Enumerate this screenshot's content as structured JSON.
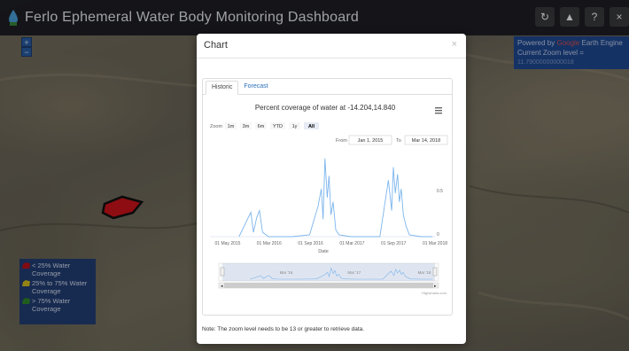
{
  "app": {
    "title": "Ferlo Ephemeral Water Body Monitoring Dashboard"
  },
  "top_icons": [
    {
      "name": "refresh-icon",
      "glyph": "↻"
    },
    {
      "name": "image-icon",
      "glyph": "▲"
    },
    {
      "name": "help-icon",
      "glyph": "?"
    },
    {
      "name": "close-icon",
      "glyph": "×"
    }
  ],
  "zoom": {
    "in": "+",
    "out": "−"
  },
  "powered": {
    "line1_prefix": "Powered by",
    "line1_mid": "Google",
    "line1_suffix": "Earth Engine",
    "line2": "Current Zoom level =",
    "line3": "11.79000000000018"
  },
  "legend": {
    "items": [
      {
        "label": "< 25% Water Coverage",
        "color": "#c0111c"
      },
      {
        "label": "25% to 75% Water Coverage",
        "color": "#d8c21f"
      },
      {
        "label": "> 75% Water Coverage",
        "color": "#2f8a2a"
      }
    ]
  },
  "modal": {
    "title": "Chart",
    "close": "×",
    "tabs": [
      {
        "label": "Historic",
        "active": true
      },
      {
        "label": "Forecast",
        "active": false
      }
    ],
    "note": "Note: The zoom level needs to be 13 or greater to retrieve data."
  },
  "chart_data": {
    "type": "line",
    "title": "Percent coverage of water at -14.204,14.840",
    "zoom_label": "Zoom",
    "range_buttons": [
      "1m",
      "3m",
      "6m",
      "YTD",
      "1y",
      "All"
    ],
    "selected_range": "All",
    "from_label": "From",
    "from_value": "Jan 1, 2015",
    "to_label": "To",
    "to_value": "Mar 14, 2018",
    "xlabel": "Date",
    "x_ticks": [
      "01 May 2015",
      "01 Mar 2016",
      "01 Sep 2016",
      "01 Mar 2017",
      "01 Sep 2017",
      "01 Mar 2018"
    ],
    "y_ticks": [
      "0",
      "0.5"
    ],
    "ylim": [
      0,
      1
    ],
    "navigator_ticks": [
      "Mar '16",
      "Mar '17",
      "Mar '18"
    ],
    "credit": "Highcharts.com",
    "line_color": "#7cb5ec",
    "series": [
      {
        "x": [
          "2015-06-01",
          "2015-08-01",
          "2015-08-15",
          "2015-09-01",
          "2015-09-15",
          "2015-10-01",
          "2015-11-01",
          "2016-01-01",
          "2016-03-01",
          "2016-06-01",
          "2016-07-15",
          "2016-08-01",
          "2016-08-10",
          "2016-08-20",
          "2016-09-01",
          "2016-09-10",
          "2016-09-20",
          "2016-10-01",
          "2016-10-15",
          "2016-11-01",
          "2017-01-01",
          "2017-03-01",
          "2017-06-01",
          "2017-07-15",
          "2017-08-01",
          "2017-08-10",
          "2017-08-20",
          "2017-09-01",
          "2017-09-10",
          "2017-09-20",
          "2017-10-01",
          "2017-10-15",
          "2017-11-01",
          "2018-01-01",
          "2018-03-01"
        ],
        "y": [
          0,
          0.28,
          0.05,
          0.22,
          0.3,
          0.05,
          0,
          0,
          0,
          0.02,
          0.35,
          0.55,
          0.2,
          0.9,
          0.45,
          0.7,
          0.25,
          0.4,
          0.08,
          0.02,
          0,
          0,
          0,
          0.65,
          0.3,
          0.8,
          0.5,
          0.72,
          0.4,
          0.55,
          0.25,
          0.12,
          0.02,
          0,
          0
        ]
      }
    ]
  }
}
